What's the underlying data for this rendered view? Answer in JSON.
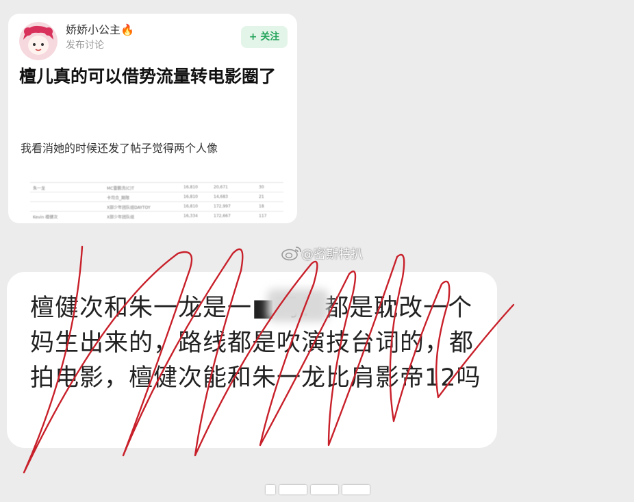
{
  "post": {
    "username": "娇娇小公主🔥",
    "subtitle": "发布讨论",
    "follow_label": "+ 关注",
    "title": "檀儿真的可以借势流量转电影圈了",
    "body": "我看消她的时候还发了帖子觉得两个人像",
    "table": {
      "rows": [
        [
          "朱一龙",
          "MC雷鹏洗(C)T",
          "16,810",
          "20,671",
          "30"
        ],
        [
          "",
          "卡司合_期限",
          "16,810",
          "14,683",
          "21"
        ],
        [
          "",
          "X部少年团队组DAYTOY",
          "16,810",
          "172,997",
          "18"
        ],
        [
          "Kevin 檀健次 ",
          "X部少年团队组",
          "16,334",
          "172,667",
          "117"
        ]
      ]
    }
  },
  "watermark": {
    "text": "@密斯特扒"
  },
  "comment": {
    "text": "檀健次和朱一龙是一■吗？都是耽改一个妈生出来的，路线都是吹演技台词的，都拍电影，檀健次能和朱一龙比肩影帝12吗"
  },
  "colors": {
    "follow_bg": "#e3f4e8",
    "follow_text": "#22a35a",
    "scribble": "#c8202a"
  }
}
